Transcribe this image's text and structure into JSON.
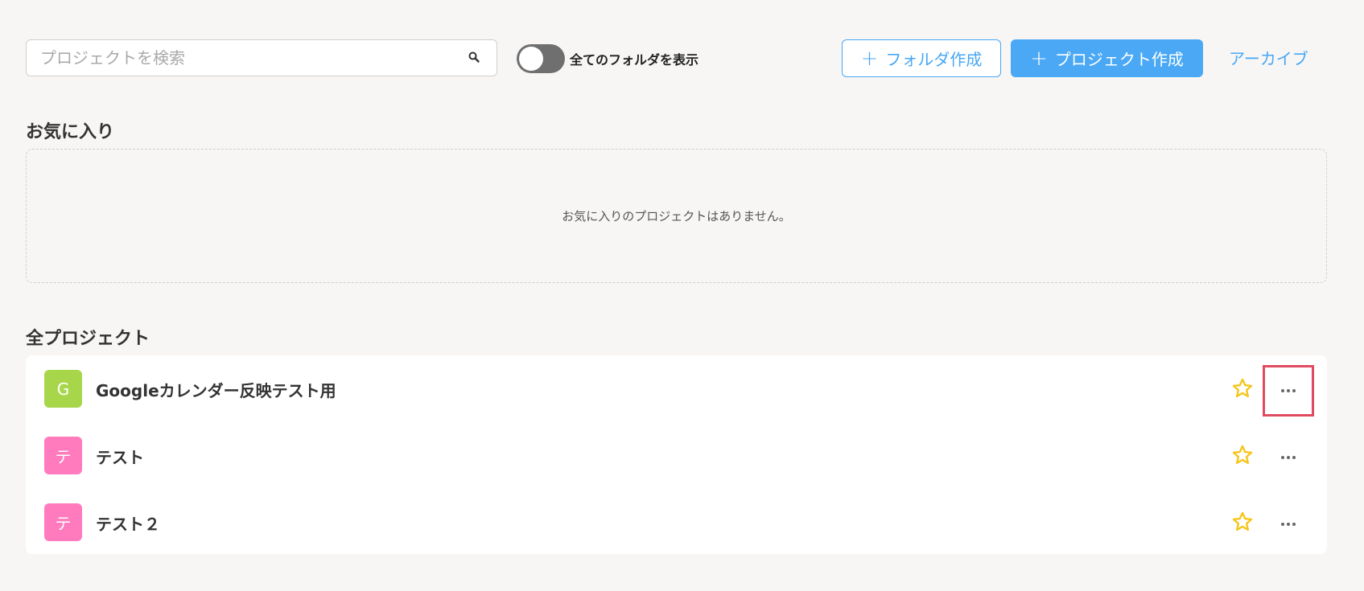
{
  "toolbar": {
    "search_placeholder": "プロジェクトを検索",
    "show_all_folders_label": "全てのフォルダを表示",
    "create_folder_label": "フォルダ作成",
    "create_project_label": "プロジェクト作成",
    "archive_label": "アーカイブ"
  },
  "favorites": {
    "title": "お気に入り",
    "empty_message": "お気に入りのプロジェクトはありません。"
  },
  "all_projects": {
    "title": "全プロジェクト",
    "items": [
      {
        "initial": "G",
        "name": "Googleカレンダー反映テスト用",
        "color": "#a8d64b"
      },
      {
        "initial": "テ",
        "name": "テスト",
        "color": "#ff7bbd"
      },
      {
        "initial": "テ",
        "name": "テスト２",
        "color": "#ff7bbd"
      }
    ]
  },
  "colors": {
    "accent": "#47a7f5",
    "star": "#f5c518",
    "highlight": "#e04b5f"
  }
}
